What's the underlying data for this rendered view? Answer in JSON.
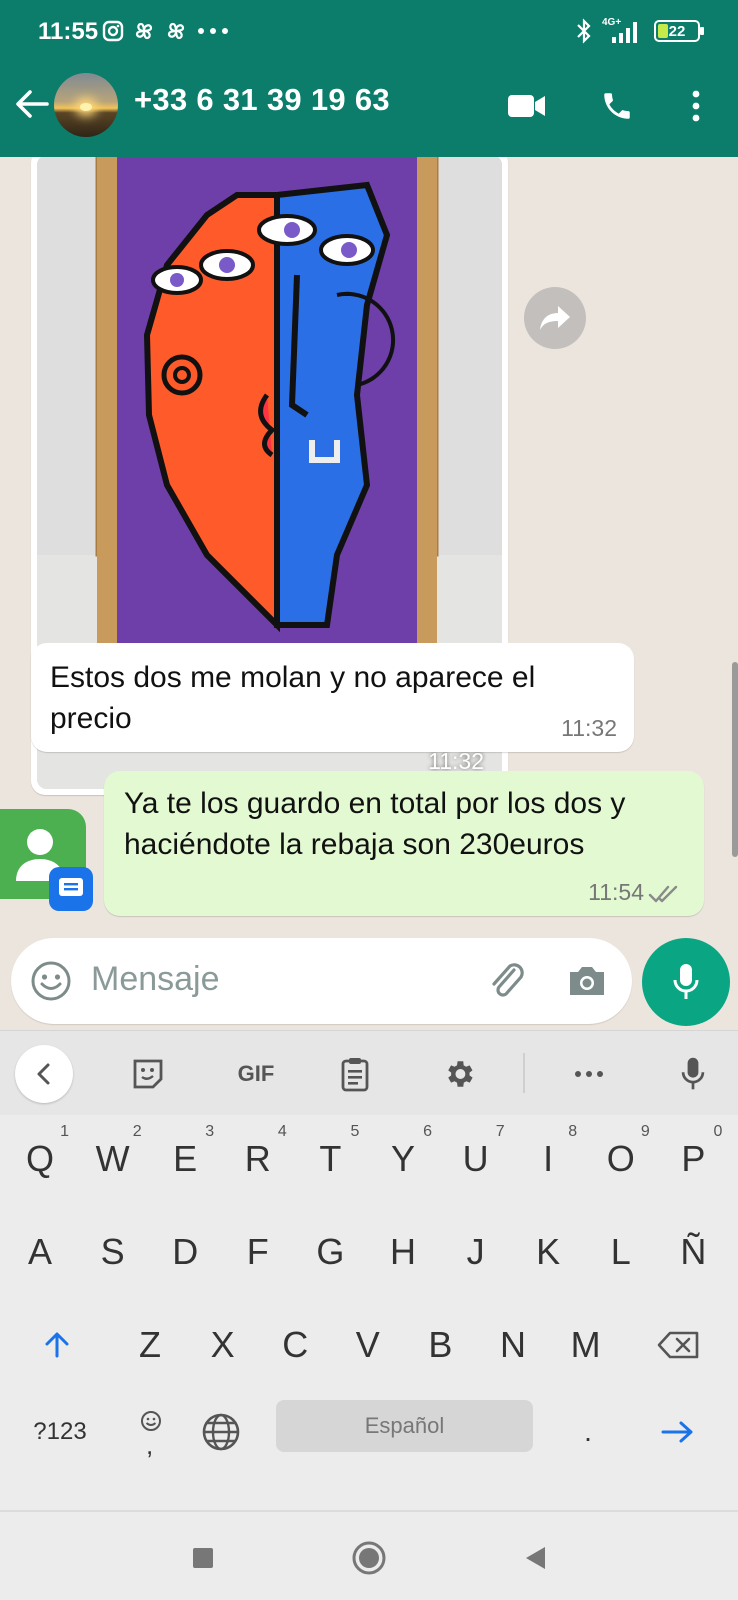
{
  "status_bar": {
    "time": "11:55",
    "network": "4G+",
    "battery": "22"
  },
  "header": {
    "contact": "+33 6 31 39 19 63"
  },
  "messages": {
    "image_time": "11:32",
    "incoming_text": "Estos dos me molan y no aparece el precio",
    "incoming_time": "11:32",
    "outgoing_text": "Ya te los guardo en total por los dos y haciéndote la rebaja son 230euros",
    "outgoing_time": "11:54"
  },
  "input": {
    "placeholder": "Mensaje"
  },
  "keyboard": {
    "toolbar_gif": "GIF",
    "row1": [
      "Q",
      "W",
      "E",
      "R",
      "T",
      "Y",
      "U",
      "I",
      "O",
      "P"
    ],
    "row1_hints": [
      "1",
      "2",
      "3",
      "4",
      "5",
      "6",
      "7",
      "8",
      "9",
      "0"
    ],
    "row2": [
      "A",
      "S",
      "D",
      "F",
      "G",
      "H",
      "J",
      "K",
      "L",
      "Ñ"
    ],
    "row3": [
      "Z",
      "X",
      "C",
      "V",
      "B",
      "N",
      "M"
    ],
    "symbols_key": "?123",
    "comma": ",",
    "space_label": "Español",
    "period": "."
  },
  "colors": {
    "header": "#0b7d6a",
    "accent": "#0aa582",
    "outgoing_bubble": "#e2f9d2"
  }
}
